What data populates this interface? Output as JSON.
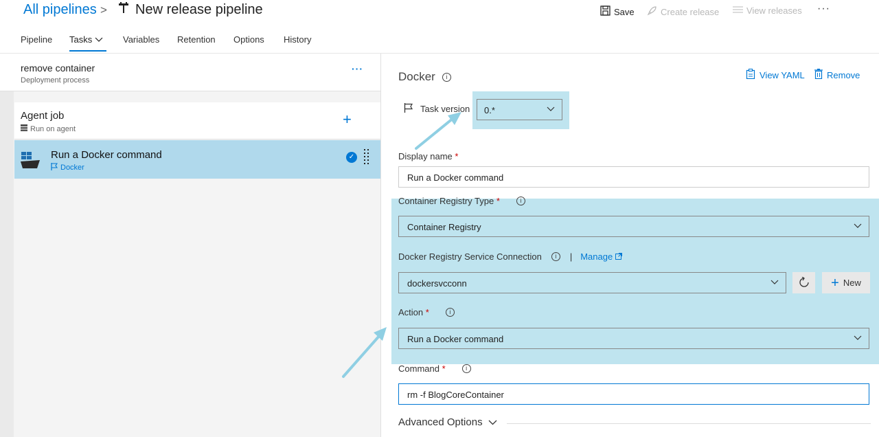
{
  "breadcrumb": {
    "root": "All pipelines",
    "separator": ">",
    "title": "New release pipeline"
  },
  "header_actions": {
    "save": "Save",
    "create_release": "Create release",
    "view_releases": "View releases",
    "more": "···"
  },
  "tabs": [
    {
      "label": "Pipeline"
    },
    {
      "label": "Tasks"
    },
    {
      "label": "Variables"
    },
    {
      "label": "Retention"
    },
    {
      "label": "Options"
    },
    {
      "label": "History"
    }
  ],
  "active_tab": "Tasks",
  "process": {
    "name": "remove container",
    "subtitle": "Deployment process",
    "more": "···"
  },
  "agent_job": {
    "title": "Agent job",
    "subtitle": "Run on agent",
    "add": "+"
  },
  "task_item": {
    "title": "Run a Docker command",
    "subtitle": "Docker"
  },
  "panel": {
    "title": "Docker",
    "view_yaml": "View YAML",
    "remove": "Remove",
    "task_version_label": "Task version",
    "task_version_value": "0.*",
    "display_name_label": "Display name",
    "display_name_value": "Run a Docker command",
    "registry_type_label": "Container Registry Type",
    "registry_type_value": "Container Registry",
    "service_conn_label": "Docker Registry Service Connection",
    "manage": "Manage",
    "service_conn_value": "dockersvcconn",
    "new_button": "New",
    "action_label": "Action",
    "action_value": "Run a Docker command",
    "command_label": "Command",
    "command_value": "rm -f BlogCoreContainer",
    "advanced": "Advanced Options",
    "required_mark": "*"
  },
  "colors": {
    "accent": "#0078d4",
    "selected_task": "#b0d9ec",
    "highlight": "#bfe4ef",
    "annotation_arrow": "#8fcfe3"
  }
}
